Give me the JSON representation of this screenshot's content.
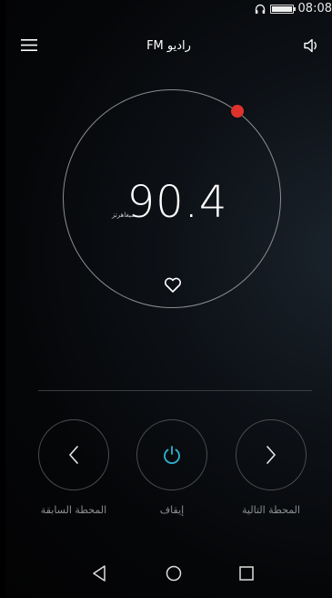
{
  "status_bar": {
    "time": "08:08",
    "icons": [
      "headphones-icon",
      "battery-icon"
    ],
    "battery_level_percent": 100
  },
  "header": {
    "title": "راديو FM",
    "left_icon": "menu-icon",
    "right_icon": "speaker-icon"
  },
  "tuner": {
    "frequency": "90.4",
    "unit": "ميغاهرتز",
    "knob_color": "#e0322c",
    "favorite_icon": "heart-outline-icon"
  },
  "controls": [
    {
      "label": "المحطة السابقة",
      "icon": "chevron-left-icon"
    },
    {
      "label": "إيقاف",
      "icon": "power-icon",
      "accent": "#2fb4d4"
    },
    {
      "label": "المحطة التالية",
      "icon": "chevron-right-icon"
    }
  ],
  "nav": {
    "icons": [
      "back-triangle-icon",
      "home-circle-icon",
      "recents-square-icon"
    ]
  }
}
